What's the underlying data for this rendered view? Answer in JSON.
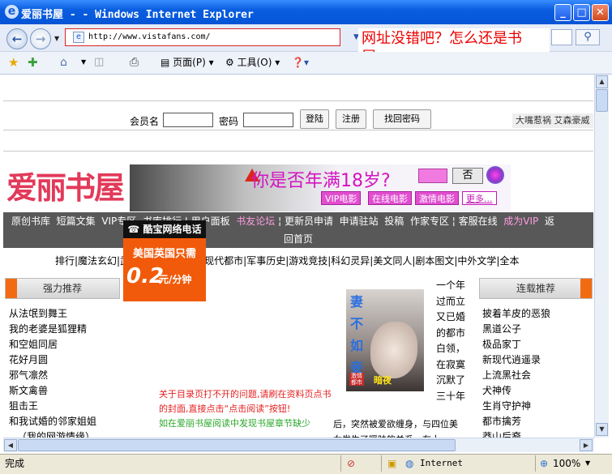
{
  "window": {
    "title": "爱丽书屋 - - Windows Internet Explorer",
    "min": "_",
    "max": "□",
    "close": "✕"
  },
  "nav": {
    "address": "http://www.vistafans.com/",
    "back": "←",
    "forward": "→",
    "annotation": "网址没错吧？怎么还是书屋。"
  },
  "cmdbar": {
    "page_label": "页面(P)",
    "tools_label": "工具(O)"
  },
  "login": {
    "member_label": "会员名",
    "password_label": "密码",
    "login_btn": "登陆",
    "register_btn": "注册",
    "recover_btn": "找回密码",
    "marquee": "大嘴惹祸 艾森豪威"
  },
  "site": {
    "logo": "爱丽书屋"
  },
  "banner": {
    "age_text": "你是否年满18岁?",
    "no_btn": "否",
    "categories": [
      "VIP电影",
      "在线电影",
      "激情电影",
      "更多..."
    ]
  },
  "menu": {
    "row1": [
      "原创书库",
      "短篇文集",
      "VIP专区",
      "书库排行",
      "用户面板",
      "书友论坛",
      "更新员申请",
      "申请驻站",
      "投稿",
      "作家专区",
      "客服在线",
      "成为VIP",
      "返"
    ],
    "row2": "回首页"
  },
  "subnav": "排行|魔法玄幻|武侠仙侠|都市言情|现代都市|军事历史|游戏竞技|科幻灵异|美文同人|剧本图文|中外文学|全本",
  "ad": {
    "top": "☎ 酷宝网络电话",
    "mid": "美国英国只需",
    "price": "0.2",
    "unit": "元/分钟"
  },
  "left_panel": {
    "title": "强力推荐",
    "items": [
      "从法氓到舞王",
      "我的老婆是狐狸精",
      "和空姐同居",
      "花好月圆",
      "邪气凛然",
      "斯文禽兽",
      "狙击王",
      "和我试婚的邻家姐姐",
      "（我的网游情缘）"
    ]
  },
  "right_panel": {
    "title": "连载推荐",
    "items": [
      "披着羊皮的恶狼",
      "黑道公子",
      "极品家丁",
      "新现代逍遥录",
      "上流黑社会",
      "犬神传",
      "生肖守护神",
      "都市擒芳",
      "莽山后裔"
    ]
  },
  "cover": {
    "title": "妻不如妾",
    "author": "暗夜",
    "badge": "激情都市"
  },
  "desc": "一个年过而立又已婚的都市白领，在寂寞沉默了三十年",
  "notice": {
    "line1": "关于目录页打不开的问题,请刷在资料页点书的封面,直接点击“点击阅读”按钮!",
    "line2": "如在爱丽书屋阅读中发现书屋章节缺少"
  },
  "story": "后，突然被爱欲缠身，与四位美女发生了暧昧的关系。在十",
  "status": {
    "left": "完成",
    "zone": "Internet",
    "zoom": "100%"
  }
}
